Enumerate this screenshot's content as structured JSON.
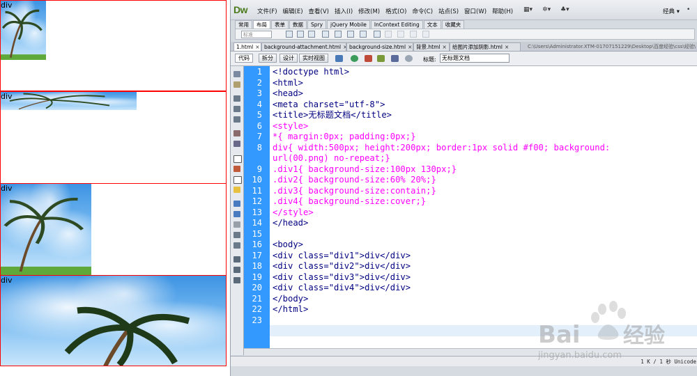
{
  "preview": {
    "boxes": [
      {
        "label": "div"
      },
      {
        "label": "div"
      },
      {
        "label": "div"
      },
      {
        "label": "div"
      }
    ]
  },
  "app": {
    "logo": "Dw",
    "menus": [
      "文件(F)",
      "编辑(E)",
      "查看(V)",
      "插入(I)",
      "修改(M)",
      "格式(O)",
      "命令(C)",
      "站点(S)",
      "窗口(W)",
      "帮助(H)"
    ],
    "workspace": "经典"
  },
  "insert_tabs": [
    "常用",
    "布局",
    "表单",
    "数据",
    "Spry",
    "jQuery Mobile",
    "InContext Editing",
    "文本",
    "收藏夹"
  ],
  "insert_bar": {
    "standard_label": "标准"
  },
  "doc_tabs": [
    {
      "label": "1.html"
    },
    {
      "label": "background-attachment.html"
    },
    {
      "label": "background-size.html"
    },
    {
      "label": "背景.html"
    },
    {
      "label": "给图片添加阴影.html"
    }
  ],
  "doc_path": "C:\\Users\\Administrator.XTM-01707151229\\Desktop\\百度经验\\css\\经验\\",
  "view_bar": {
    "buttons": [
      "代码",
      "拆分",
      "设计",
      "实时视图"
    ],
    "title_label": "标题:",
    "title_value": "无标题文档"
  },
  "editor": {
    "line_numbers": [
      "1",
      "2",
      "3",
      "4",
      "5",
      "6",
      "7",
      "8",
      "",
      "9",
      "10",
      "11",
      "12",
      "13",
      "14",
      "15",
      "16",
      "17",
      "18",
      "19",
      "20",
      "21",
      "22",
      "23"
    ],
    "lines": [
      {
        "cls": "c-tag",
        "text": "<!doctype html>"
      },
      {
        "cls": "c-tag",
        "text": "<html>"
      },
      {
        "cls": "c-tag",
        "text": "<head>"
      },
      {
        "cls": "c-tag",
        "text": "<meta charset=\"utf-8\">"
      },
      {
        "cls": "c-tag",
        "text": "<title>无标题文档</title>"
      },
      {
        "cls": "c-css",
        "text": "<style>"
      },
      {
        "cls": "c-css",
        "text": "*{ margin:0px; padding:0px;}"
      },
      {
        "cls": "c-css",
        "text": "div{ width:500px; height:200px; border:1px solid #f00; background:"
      },
      {
        "cls": "c-css",
        "text": "url(00.png) no-repeat;}"
      },
      {
        "cls": "c-css",
        "text": ".div1{ background-size:100px 130px;}"
      },
      {
        "cls": "c-css",
        "text": ".div2{ background-size:60% 20%;}"
      },
      {
        "cls": "c-css",
        "text": ".div3{ background-size:contain;}"
      },
      {
        "cls": "c-css",
        "text": ".div4{ background-size:cover;}"
      },
      {
        "cls": "c-css",
        "text": "</style>"
      },
      {
        "cls": "c-tag",
        "text": "</head>"
      },
      {
        "cls": "c-tag",
        "text": ""
      },
      {
        "cls": "c-tag",
        "text": "<body>"
      },
      {
        "cls": "c-tag",
        "text": "<div class=\"div1\">div</div>"
      },
      {
        "cls": "c-tag",
        "text": "<div class=\"div2\">div</div>"
      },
      {
        "cls": "c-tag",
        "text": "<div class=\"div3\">div</div>"
      },
      {
        "cls": "c-tag",
        "text": "<div class=\"div4\">div</div>"
      },
      {
        "cls": "c-tag",
        "text": "</body>"
      },
      {
        "cls": "c-tag",
        "text": "</html>"
      },
      {
        "cls": "c-tag",
        "text": ""
      }
    ]
  },
  "status_bar": {
    "text": "1 K / 1 秒 Unicode"
  },
  "watermark": {
    "brand": "Bai du 经验",
    "url": "jingyan.baidu.com"
  }
}
